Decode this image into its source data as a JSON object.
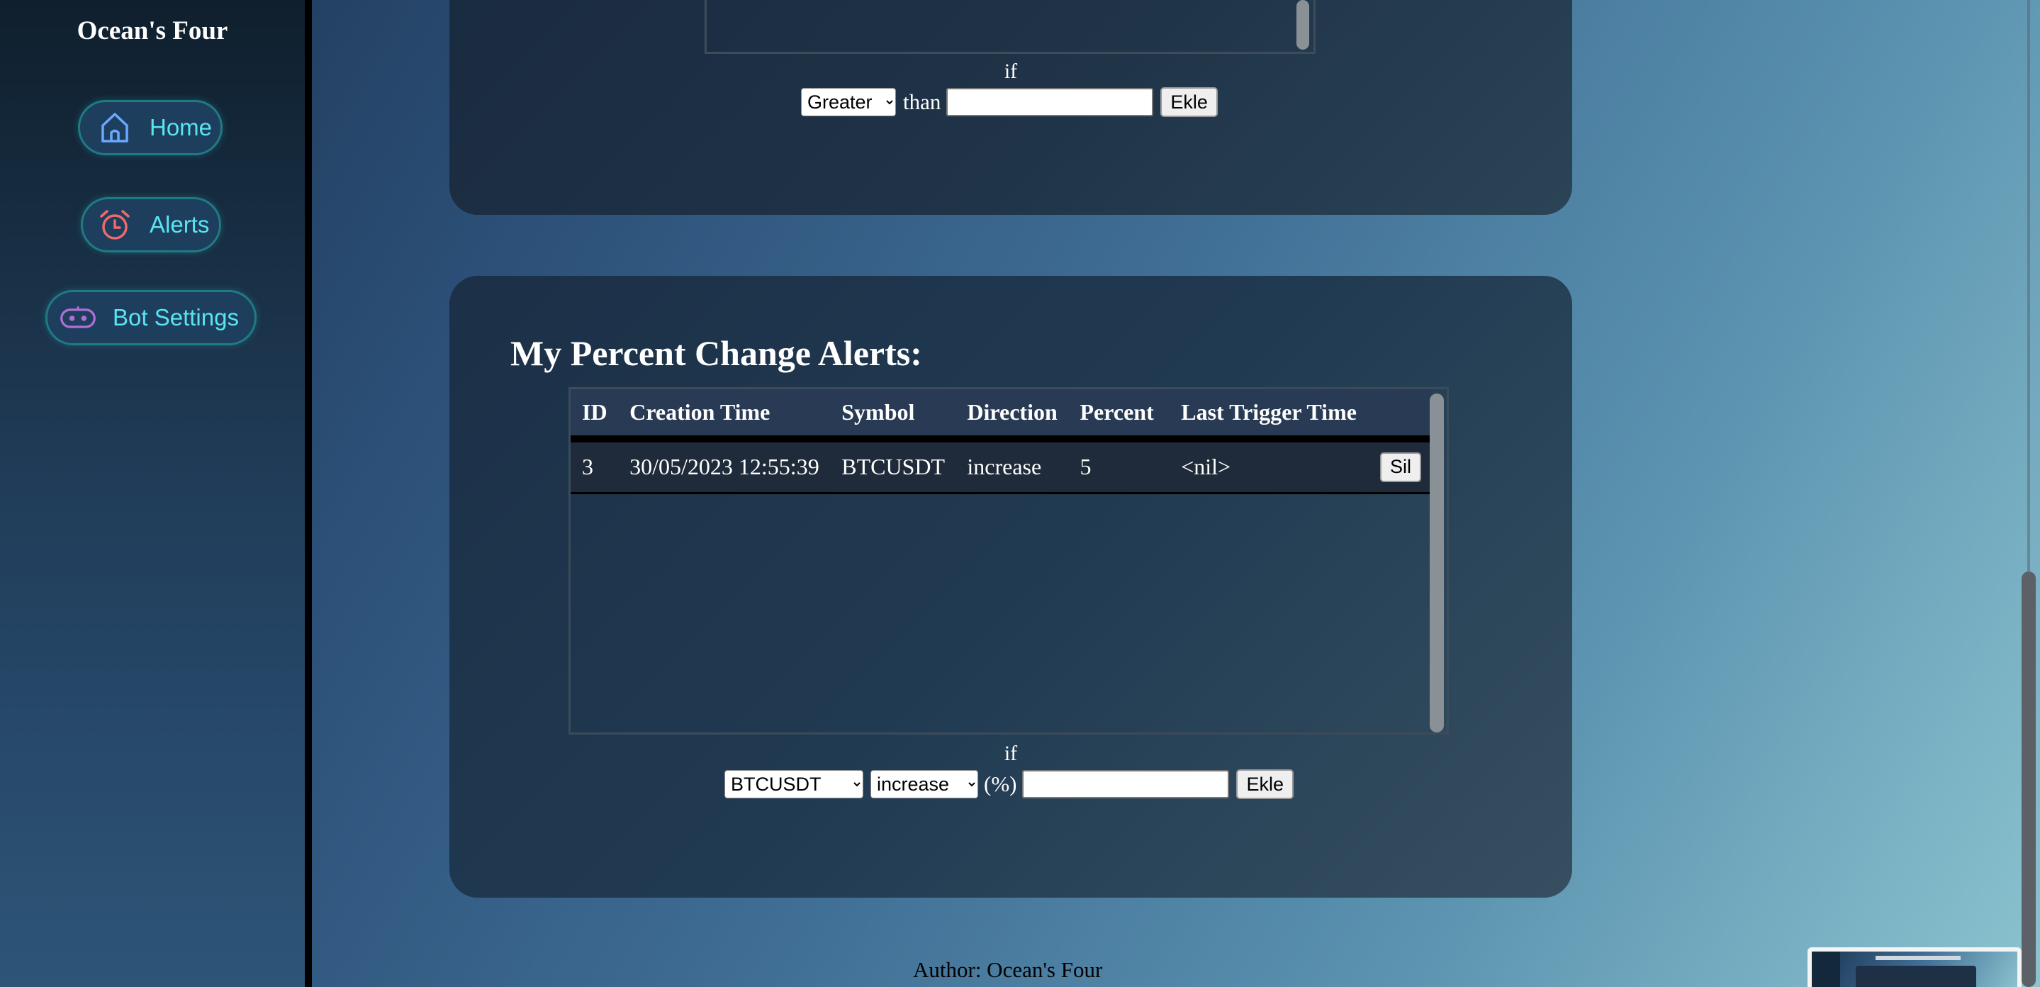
{
  "sidebar": {
    "brand": "Ocean's Four",
    "items": [
      {
        "label": "Home",
        "icon": "home-icon",
        "icon_color": "#6aa8ff"
      },
      {
        "label": "Alerts",
        "icon": "alarm-clock-icon",
        "icon_color": "#f06a6a"
      },
      {
        "label": "Bot Settings",
        "icon": "robot-icon",
        "icon_color": "#b06fd6"
      }
    ]
  },
  "price_alert_form": {
    "if_label": "if",
    "comparison_selected": "Greater",
    "than_label": "than",
    "value": "",
    "add_button": "Ekle"
  },
  "percent_alerts": {
    "title": "My Percent Change Alerts:",
    "columns": [
      "ID",
      "Creation Time",
      "Symbol",
      "Direction",
      "Percent",
      "Last Trigger Time"
    ],
    "rows": [
      {
        "id": "3",
        "creation_time": "30/05/2023 12:55:39",
        "symbol": "BTCUSDT",
        "direction": "increase",
        "percent": "5",
        "last_trigger_time": "<nil>",
        "delete_button": "Sil"
      }
    ],
    "form": {
      "if_label": "if",
      "symbol_selected": "BTCUSDT",
      "direction_selected": "increase",
      "percent_label": "(%)",
      "value": "",
      "add_button": "Ekle"
    }
  },
  "footer": {
    "text": "Author: Ocean's Four"
  },
  "colors": {
    "nav_text": "#59e4ef",
    "nav_border": "#1f7b83"
  }
}
